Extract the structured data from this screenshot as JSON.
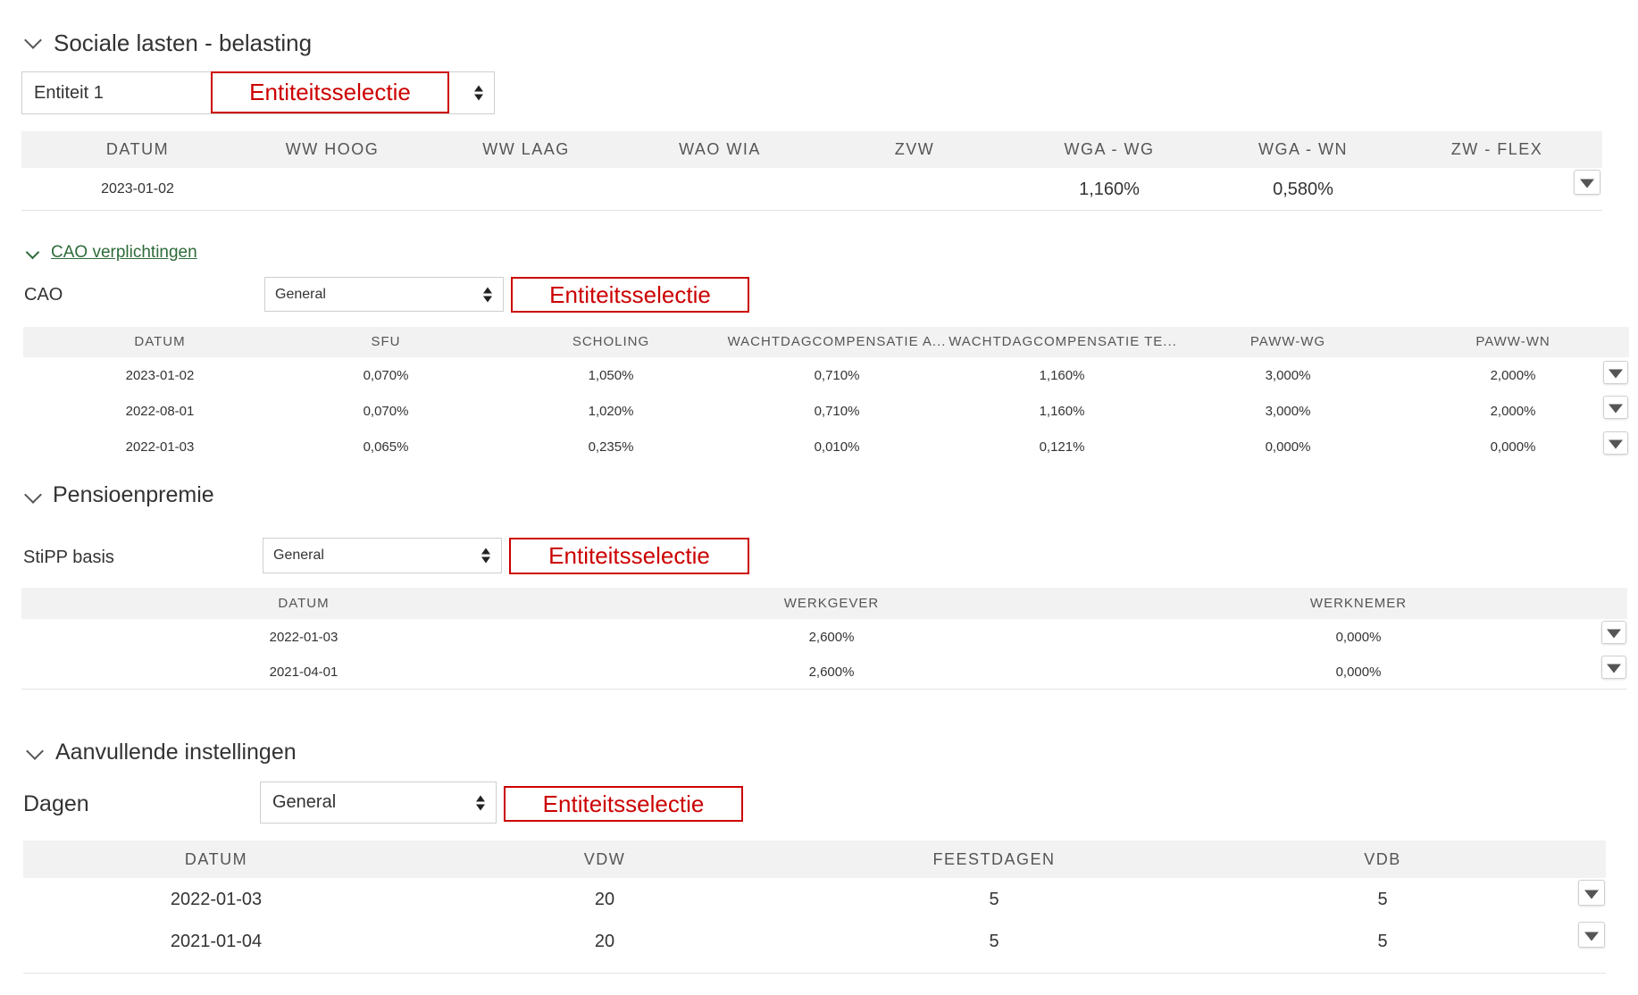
{
  "entity_box_label": "Entiteitsselectie",
  "sociale": {
    "title": "Sociale lasten - belasting",
    "entity_value": "Entiteit 1",
    "headers": [
      "DATUM",
      "WW HOOG",
      "WW LAAG",
      "WAO WIA",
      "ZVW",
      "WGA - WG",
      "WGA - WN",
      "ZW - FLEX"
    ],
    "rows": [
      [
        "2023-01-02",
        "",
        "",
        "",
        "",
        "1,160%",
        "0,580%",
        ""
      ]
    ]
  },
  "cao": {
    "link_text": "CAO verplichtingen",
    "label": "CAO",
    "select_value": "General",
    "headers": [
      "DATUM",
      "SFU",
      "SCHOLING",
      "WACHTDAGCOMPENSATIE A...",
      "WACHTDAGCOMPENSATIE TE...",
      "PAWW-WG",
      "PAWW-WN"
    ],
    "rows": [
      [
        "2023-01-02",
        "0,070%",
        "1,050%",
        "0,710%",
        "1,160%",
        "3,000%",
        "2,000%"
      ],
      [
        "2022-08-01",
        "0,070%",
        "1,020%",
        "0,710%",
        "1,160%",
        "3,000%",
        "2,000%"
      ],
      [
        "2022-01-03",
        "0,065%",
        "0,235%",
        "0,010%",
        "0,121%",
        "0,000%",
        "0,000%"
      ]
    ]
  },
  "pensioen": {
    "title": "Pensioenpremie",
    "label": "StiPP basis",
    "select_value": "General",
    "headers": [
      "DATUM",
      "WERKGEVER",
      "WERKNEMER"
    ],
    "rows": [
      [
        "2022-01-03",
        "2,600%",
        "0,000%"
      ],
      [
        "2021-04-01",
        "2,600%",
        "0,000%"
      ]
    ]
  },
  "aanvullend": {
    "title": "Aanvullende instellingen",
    "label": "Dagen",
    "select_value": "General",
    "headers": [
      "DATUM",
      "VDW",
      "FEESTDAGEN",
      "VDB"
    ],
    "rows": [
      [
        "2022-01-03",
        "20",
        "5",
        "5"
      ],
      [
        "2021-01-04",
        "20",
        "5",
        "5"
      ]
    ]
  }
}
